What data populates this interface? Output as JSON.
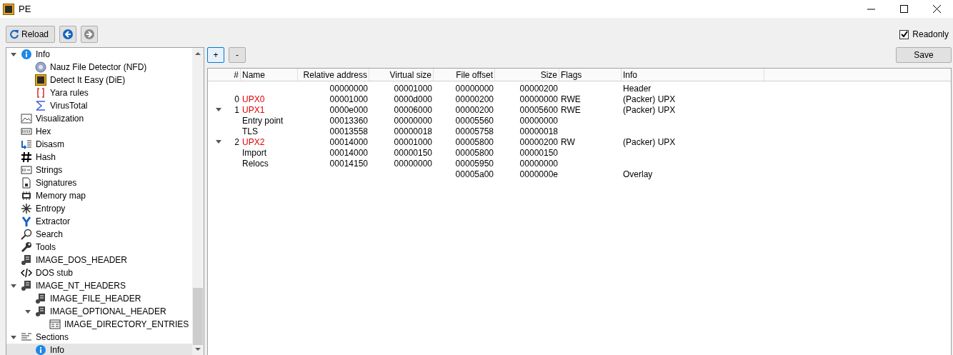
{
  "window": {
    "title": "PE"
  },
  "toolbar": {
    "reload": "Reload",
    "back_disabled": false,
    "forward_disabled": true,
    "readonly": {
      "label": "Readonly",
      "checked": true
    }
  },
  "tree": [
    {
      "label": "Info",
      "kind": "info",
      "expanded": true,
      "selected": false,
      "children": [
        {
          "label": "Nauz File Detector (NFD)",
          "kind": "nfd",
          "selected": false
        },
        {
          "label": "Detect It Easy (DiE)",
          "kind": "die",
          "selected": false
        },
        {
          "label": "Yara rules",
          "kind": "yara",
          "selected": false
        },
        {
          "label": "VirusTotal",
          "kind": "virustotal",
          "selected": false
        }
      ]
    },
    {
      "label": "Visualization",
      "kind": "visualization",
      "selected": false
    },
    {
      "label": "Hex",
      "kind": "hex",
      "selected": false
    },
    {
      "label": "Disasm",
      "kind": "disasm",
      "selected": false
    },
    {
      "label": "Hash",
      "kind": "hash",
      "selected": false
    },
    {
      "label": "Strings",
      "kind": "strings",
      "selected": false
    },
    {
      "label": "Signatures",
      "kind": "signatures",
      "selected": false
    },
    {
      "label": "Memory map",
      "kind": "memory",
      "selected": false
    },
    {
      "label": "Entropy",
      "kind": "entropy",
      "selected": false
    },
    {
      "label": "Extractor",
      "kind": "extractor",
      "selected": false
    },
    {
      "label": "Search",
      "kind": "search",
      "selected": false
    },
    {
      "label": "Tools",
      "kind": "tools",
      "selected": false
    },
    {
      "label": "IMAGE_DOS_HEADER",
      "kind": "header",
      "selected": false
    },
    {
      "label": "DOS stub",
      "kind": "code",
      "selected": false
    },
    {
      "label": "IMAGE_NT_HEADERS",
      "kind": "header",
      "expanded": true,
      "selected": false,
      "children": [
        {
          "label": "IMAGE_FILE_HEADER",
          "kind": "header",
          "selected": false
        },
        {
          "label": "IMAGE_OPTIONAL_HEADER",
          "kind": "header",
          "expanded": true,
          "selected": false,
          "children": [
            {
              "label": "IMAGE_DIRECTORY_ENTRIES",
              "kind": "directory",
              "selected": false
            }
          ]
        }
      ]
    },
    {
      "label": "Sections",
      "kind": "sections",
      "expanded": true,
      "selected": false,
      "children": [
        {
          "label": "Info",
          "kind": "info",
          "selected": true
        }
      ]
    }
  ],
  "panel": {
    "buttons": [
      "+",
      "-"
    ],
    "save": "Save"
  },
  "table": {
    "columns": [
      "#",
      "Name",
      "Relative address",
      "Virtual size",
      "File offset",
      "Size",
      "Flags",
      "Info"
    ],
    "rows": [
      {
        "kind": "plain",
        "cells": [
          "",
          "",
          "00000000",
          "00001000",
          "00000000",
          "00000200",
          "",
          "Header"
        ]
      },
      {
        "kind": "section",
        "cells": [
          "0",
          "UPX0",
          "00001000",
          "0000d000",
          "00000200",
          "00000000",
          "RWE",
          "(Packer) UPX"
        ]
      },
      {
        "kind": "section",
        "expanded": true,
        "cells": [
          "1",
          "UPX1",
          "0000e000",
          "00006000",
          "00000200",
          "00005600",
          "RWE",
          "(Packer) UPX"
        ],
        "children": [
          {
            "kind": "plain",
            "cells": [
              "",
              "Entry point",
              "00013360",
              "00000000",
              "00005560",
              "00000000",
              "",
              ""
            ]
          },
          {
            "kind": "plain",
            "cells": [
              "",
              "TLS",
              "00013558",
              "00000018",
              "00005758",
              "00000018",
              "",
              ""
            ]
          }
        ]
      },
      {
        "kind": "section",
        "expanded": true,
        "cells": [
          "2",
          "UPX2",
          "00014000",
          "00001000",
          "00005800",
          "00000200",
          "RW",
          "(Packer) UPX"
        ],
        "children": [
          {
            "kind": "plain",
            "cells": [
              "",
              "Import",
              "00014000",
              "00000150",
              "00005800",
              "00000150",
              "",
              ""
            ]
          },
          {
            "kind": "plain",
            "cells": [
              "",
              "Relocs",
              "00014150",
              "00000000",
              "00005950",
              "00000000",
              "",
              ""
            ]
          }
        ]
      },
      {
        "kind": "plain",
        "cells": [
          "",
          "",
          "",
          "",
          "00005a00",
          "0000000e",
          "",
          "Overlay"
        ]
      }
    ]
  }
}
